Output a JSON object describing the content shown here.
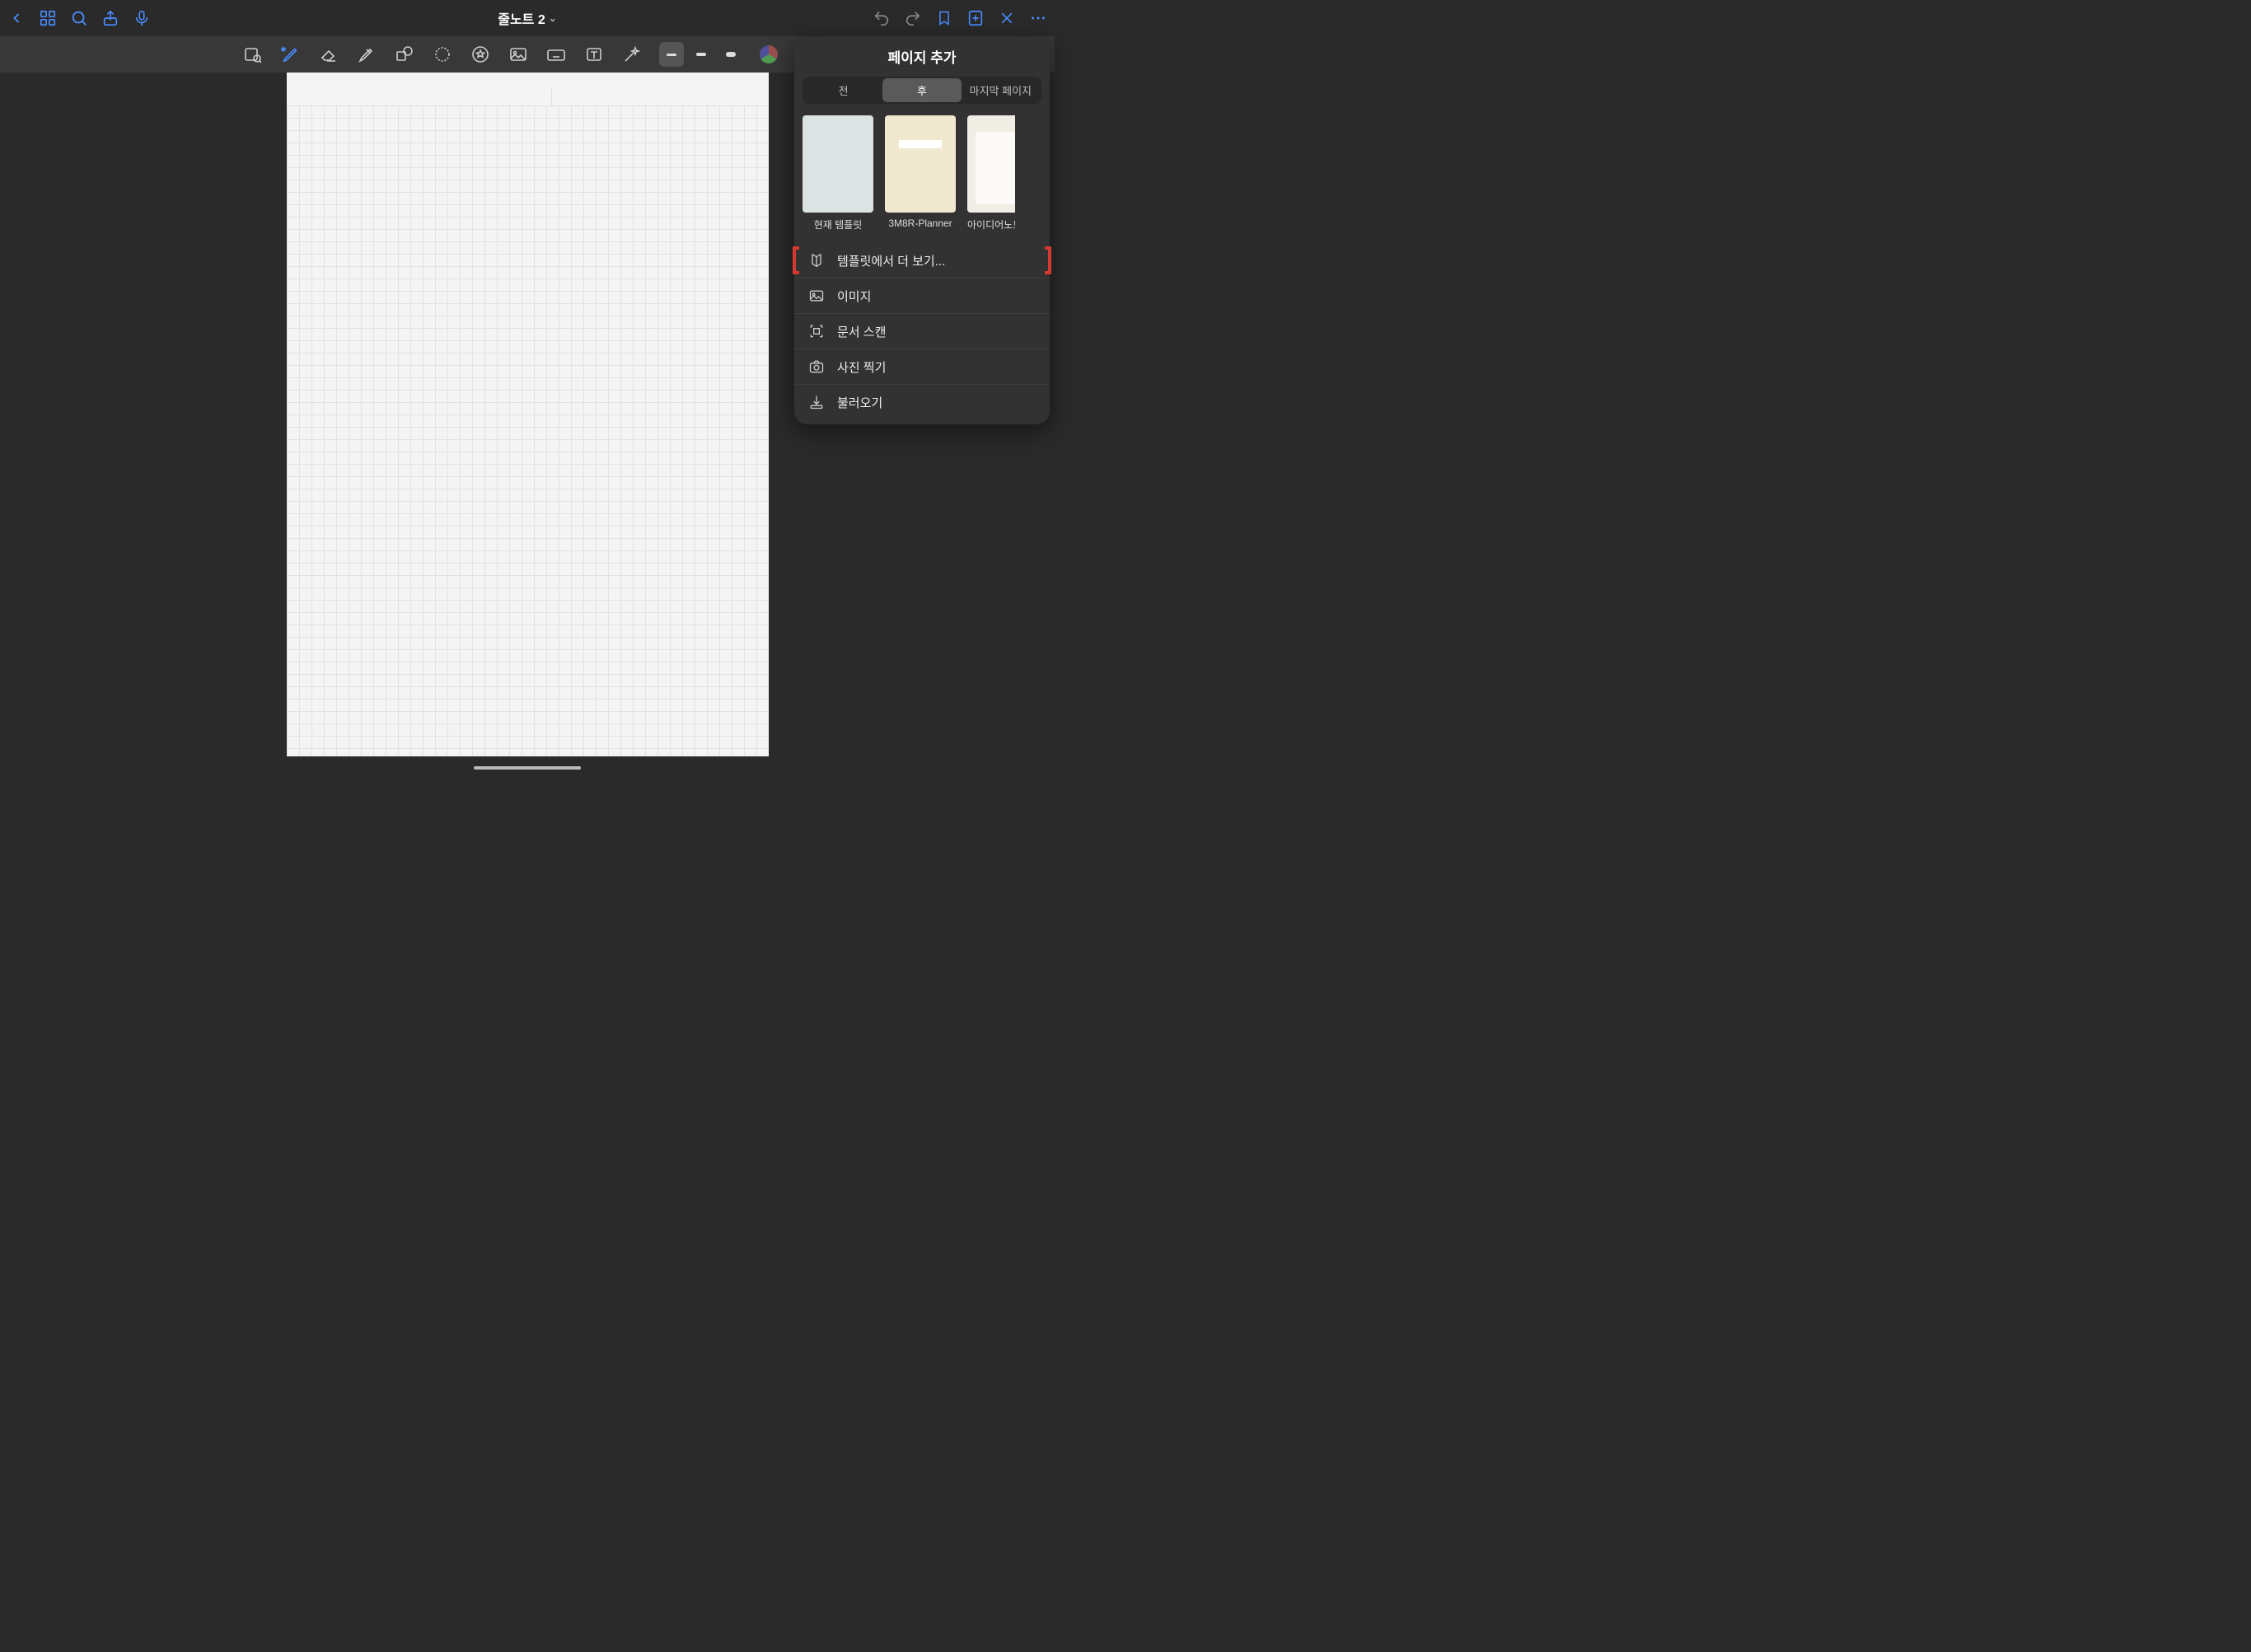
{
  "document_title": "줄노트 2",
  "panel": {
    "title": "페이지 추가",
    "segments": {
      "before": "전",
      "after": "후",
      "last": "마지막 페이지"
    },
    "templates": [
      {
        "label": "현재 템플릿"
      },
      {
        "label": "3M8R-Planner"
      },
      {
        "label": "아이디어노트"
      }
    ],
    "actions": {
      "more_templates": "템플릿에서 더 보기...",
      "image": "이미지",
      "scan": "문서 스캔",
      "camera": "사진 찍기",
      "import": "불러오기"
    }
  },
  "colors": {
    "accent": "#4a8cff",
    "pen_color": "#e56a5a"
  }
}
